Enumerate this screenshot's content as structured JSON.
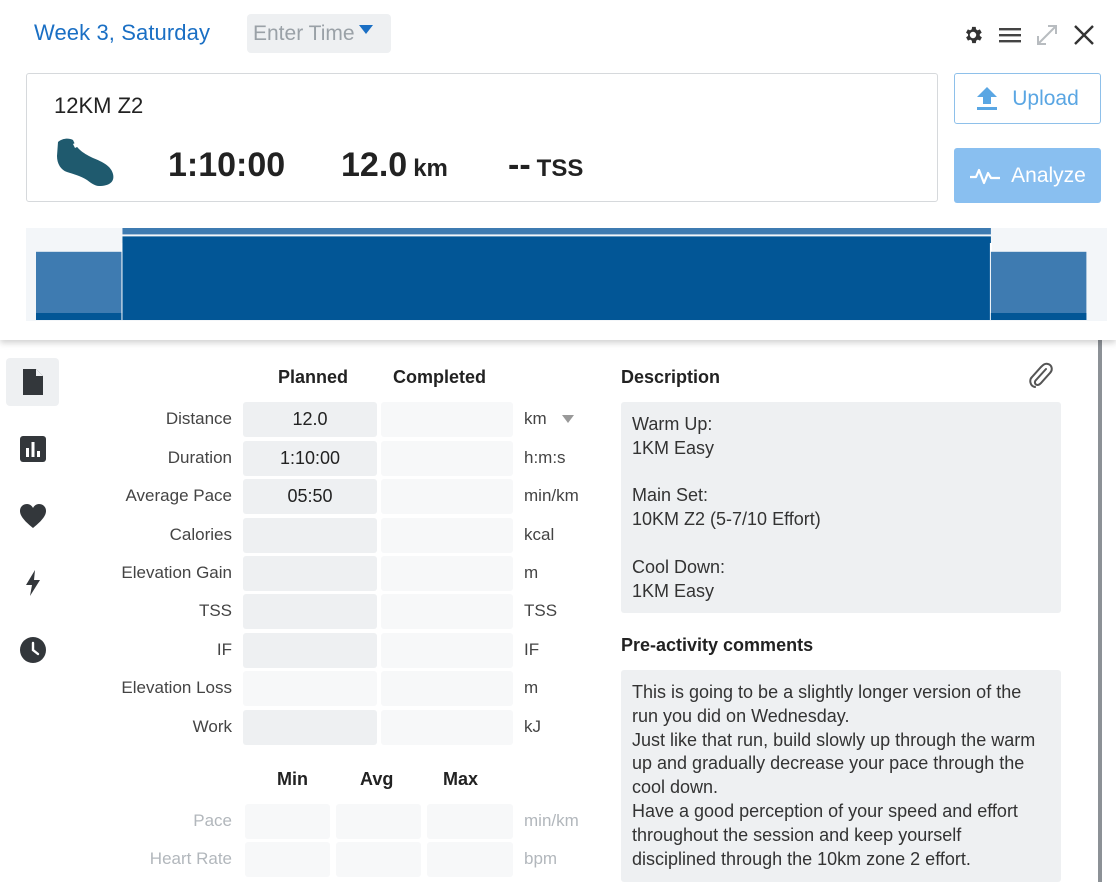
{
  "header": {
    "day_title": "Week 3, Saturday",
    "time_placeholder": "Enter Time",
    "workout_title": "12KM Z2",
    "duration": "1:10:00",
    "distance_value": "12.0",
    "distance_unit": "km",
    "tss_value": "--",
    "tss_unit": "TSS",
    "upload_label": "Upload",
    "analyze_label": "Analyze",
    "icons": [
      "gear-icon",
      "menu-icon",
      "expand-icon",
      "close-icon"
    ]
  },
  "intensity_profile": {
    "segments": [
      {
        "label": "warm-up",
        "duration_share": 0.0815,
        "level": 0.62
      },
      {
        "label": "main-set",
        "duration_share": 0.8185,
        "level": 0.76
      },
      {
        "label": "cool-down",
        "duration_share": 0.09,
        "level": 0.62
      }
    ]
  },
  "sidebar": {
    "items": [
      {
        "name": "summary",
        "icon": "document-icon",
        "active": true
      },
      {
        "name": "charts",
        "icon": "bar-chart-icon",
        "active": false
      },
      {
        "name": "heart",
        "icon": "heart-icon",
        "active": false
      },
      {
        "name": "power",
        "icon": "lightning-icon",
        "active": false
      },
      {
        "name": "history",
        "icon": "clock-icon",
        "active": false
      }
    ]
  },
  "metrics": {
    "planned_header": "Planned",
    "completed_header": "Completed",
    "rows": [
      {
        "label": "Distance",
        "planned": "12.0",
        "completed": "",
        "unit": "km"
      },
      {
        "label": "Duration",
        "planned": "1:10:00",
        "completed": "",
        "unit": "h:m:s"
      },
      {
        "label": "Average Pace",
        "planned": "05:50",
        "completed": "",
        "unit": "min/km"
      },
      {
        "label": "Calories",
        "planned": "",
        "completed": "",
        "unit": "kcal"
      },
      {
        "label": "Elevation Gain",
        "planned": "",
        "completed": "",
        "unit": "m"
      },
      {
        "label": "TSS",
        "planned": "",
        "completed": "",
        "unit": "TSS"
      },
      {
        "label": "IF",
        "planned": "",
        "completed": "",
        "unit": "IF"
      },
      {
        "label": "Elevation Loss",
        "planned": "",
        "completed": "",
        "unit": "m"
      },
      {
        "label": "Work",
        "planned": "",
        "completed": "",
        "unit": "kJ"
      }
    ],
    "range_headers": {
      "min": "Min",
      "avg": "Avg",
      "max": "Max"
    },
    "range_rows": [
      {
        "label": "Pace",
        "unit": "min/km"
      },
      {
        "label": "Heart Rate",
        "unit": "bpm"
      }
    ]
  },
  "description": {
    "title": "Description",
    "text": "Warm Up:\n1KM Easy\n\nMain Set:\n10KM Z2 (5-7/10 Effort)\n\nCool Down:\n1KM Easy"
  },
  "pre_activity": {
    "title": "Pre-activity comments",
    "text": "This is going to be a slightly longer version of the run you did on Wednesday.\nJust like that run, build slowly up through the warm up and gradually decrease your pace through the cool down.\nHave a good perception of your speed and effort throughout the session and keep yourself disciplined through the 10km zone 2 effort."
  },
  "colors": {
    "accent": "#1a6fc4",
    "bar_main": "#025696",
    "bar_side": "#3e7bb1",
    "analyze_bg": "#89bff0"
  }
}
